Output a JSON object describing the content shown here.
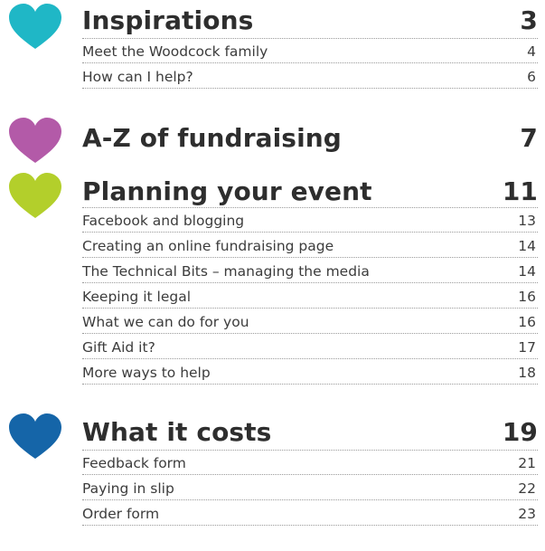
{
  "sections": [
    {
      "title": "Inspirations",
      "page": "3",
      "heart_color": "#1fb7c6",
      "icon": "heart-icon",
      "items": [
        {
          "label": "Meet the Woodcock family",
          "page": "4"
        },
        {
          "label": "How can I help?",
          "page": "6"
        }
      ]
    },
    {
      "title": "A-Z of fundraising",
      "page": "7",
      "heart_color": "#b35aa8",
      "icon": "heart-icon",
      "items": []
    },
    {
      "title": "Planning your event",
      "page": "11",
      "heart_color": "#b3cf2b",
      "icon": "heart-icon",
      "items": [
        {
          "label": "Facebook and blogging",
          "page": "13"
        },
        {
          "label": "Creating an online fundraising page",
          "page": "14"
        },
        {
          "label": "The Technical Bits – managing the media",
          "page": "14"
        },
        {
          "label": "Keeping it legal",
          "page": "16"
        },
        {
          "label": "What we can do for you",
          "page": "16"
        },
        {
          "label": "Gift Aid it?",
          "page": "17"
        },
        {
          "label": "More ways to help",
          "page": "18"
        }
      ]
    },
    {
      "title": "What it costs",
      "page": "19",
      "heart_color": "#1565a8",
      "icon": "heart-icon",
      "items": [
        {
          "label": "Feedback form",
          "page": "21"
        },
        {
          "label": "Paying in slip",
          "page": "22"
        },
        {
          "label": "Order form",
          "page": "23"
        }
      ]
    }
  ]
}
